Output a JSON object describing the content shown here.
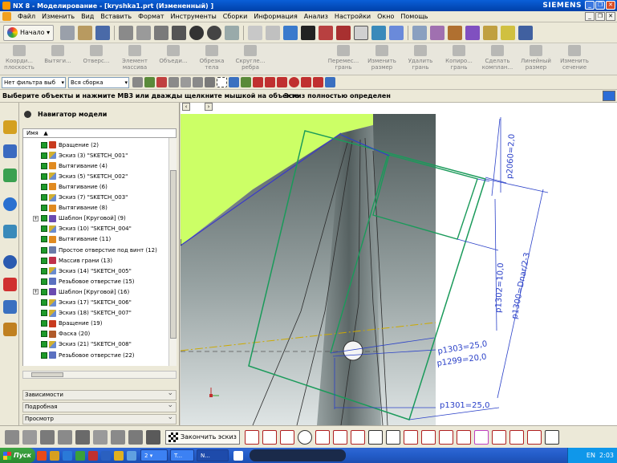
{
  "window": {
    "title": "NX 8 - Моделирование - [kryshka1.prt (Измененный) ]",
    "brand": "SIEMENS"
  },
  "menu": [
    "Файл",
    "Изменить",
    "Вид",
    "Вставить",
    "Формат",
    "Инструменты",
    "Сборки",
    "Информация",
    "Анализ",
    "Настройки",
    "Окно",
    "Помощь"
  ],
  "toolbar": {
    "start_label": "Начало"
  },
  "features": [
    {
      "label1": "Коорди...",
      "label2": "плоскость"
    },
    {
      "label1": "Вытяги...",
      "label2": ""
    },
    {
      "label1": "Отверс...",
      "label2": ""
    },
    {
      "label1": "Элемент",
      "label2": "массива"
    },
    {
      "label1": "Объеди...",
      "label2": ""
    },
    {
      "label1": "Обрезка",
      "label2": "тела"
    },
    {
      "label1": "Скругле...",
      "label2": "ребра"
    },
    {
      "label1": "Перемес...",
      "label2": "грань"
    },
    {
      "label1": "Изменить",
      "label2": "размер"
    },
    {
      "label1": "Удалить",
      "label2": "грань"
    },
    {
      "label1": "Копиро...",
      "label2": "грань"
    },
    {
      "label1": "Сделать",
      "label2": "комплан..."
    },
    {
      "label1": "Линейный",
      "label2": "размер"
    },
    {
      "label1": "Изменить",
      "label2": "сечение"
    }
  ],
  "filters": {
    "type_filter": "Нет фильтра выб",
    "scope": "Вся сборка"
  },
  "cue": "Выберите объекты и нажмите MB3 или дважды щелкните мышкой на объекте",
  "status": "Эскиз полностью определен",
  "navigator": {
    "title": "Навигатор модели",
    "column": "Имя",
    "items": [
      {
        "label": "Вращение (2)",
        "icon": "revolve",
        "exp": ""
      },
      {
        "label": "Эскиз (3) \"SKETCH_001\"",
        "icon": "sketch",
        "exp": ""
      },
      {
        "label": "Вытягивание (4)",
        "icon": "extrude",
        "exp": ""
      },
      {
        "label": "Эскиз (5) \"SKETCH_002\"",
        "icon": "sketch",
        "exp": ""
      },
      {
        "label": "Вытягивание (6)",
        "icon": "extrude",
        "exp": ""
      },
      {
        "label": "Эскиз (7) \"SKETCH_003\"",
        "icon": "sketch",
        "exp": ""
      },
      {
        "label": "Вытягивание (8)",
        "icon": "extrude",
        "exp": ""
      },
      {
        "label": "Шаблон [Круговой] (9)",
        "icon": "pattern",
        "exp": "+"
      },
      {
        "label": "Эскиз (10) \"SKETCH_004\"",
        "icon": "sketch",
        "exp": ""
      },
      {
        "label": "Вытягивание (11)",
        "icon": "extrude",
        "exp": ""
      },
      {
        "label": "Простое отверстие под винт (12)",
        "icon": "hole",
        "exp": ""
      },
      {
        "label": "Массив грани (13)",
        "icon": "array",
        "exp": ""
      },
      {
        "label": "Эскиз (14) \"SKETCH_005\"",
        "icon": "sketch",
        "exp": ""
      },
      {
        "label": "Резьбовое отверстие (15)",
        "icon": "thread",
        "exp": ""
      },
      {
        "label": "Шаблон [Круговой] (16)",
        "icon": "pattern",
        "exp": "+"
      },
      {
        "label": "Эскиз (17) \"SKETCH_006\"",
        "icon": "sketch",
        "exp": ""
      },
      {
        "label": "Эскиз (18) \"SKETCH_007\"",
        "icon": "sketch",
        "exp": ""
      },
      {
        "label": "Вращение (19)",
        "icon": "revolve",
        "exp": ""
      },
      {
        "label": "Фаска (20)",
        "icon": "chamfer",
        "exp": ""
      },
      {
        "label": "Эскиз (21) \"SKETCH_008\"",
        "icon": "sketch",
        "exp": ""
      },
      {
        "label": "Резьбовое отверстие (22)",
        "icon": "thread",
        "exp": ""
      }
    ],
    "panels": [
      "Зависимости",
      "Подробная",
      "Просмотр"
    ]
  },
  "dimensions": {
    "d1": "p2060=2,0",
    "d2": "p1302=10,0",
    "d3": "p1300=Dnar/2-3",
    "d4": "p1303=25,0",
    "d5": "p1299=20,0",
    "d6": "p1301=25,0"
  },
  "sketch_toolbar": {
    "finish_label": "Закончить эскиз"
  },
  "taskbar": {
    "start_label": "Пуск",
    "task1": "2",
    "task2": "T...",
    "task3": "N...",
    "lang": "EN",
    "time": "2:03"
  },
  "colors": {
    "sketch": "#1a9a5a",
    "dim": "#2a40c8",
    "face": "#ccff66",
    "accent": "#0a5fd8"
  }
}
